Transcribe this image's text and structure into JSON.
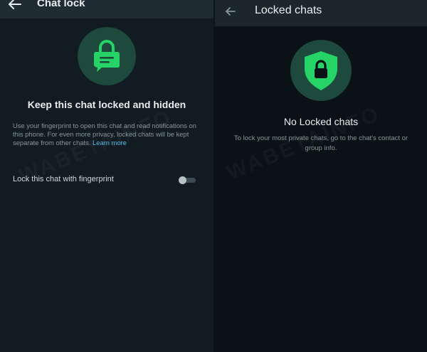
{
  "chat_lock_screen": {
    "title": "Chat lock",
    "heading": "Keep this chat locked and hidden",
    "description": "Use your fingerprint to open this chat and read notifications on this phone. For even more privacy, locked chats will be kept separate from other chats.",
    "learn_more": "Learn more",
    "fingerprint_label": "Lock this chat with fingerprint",
    "fingerprint_enabled": false,
    "icon": "chat-lock-icon"
  },
  "locked_chats_screen": {
    "title": "Locked chats",
    "heading": "No Locked chats",
    "description": "To lock your most private chats, go to the chat's contact or group info.",
    "icon": "shield-lock-icon"
  },
  "watermark": "WABETAINFO",
  "colors": {
    "accent_green": "#25d366",
    "badge_bg": "#1d4a3c",
    "background": "#111b21",
    "link_blue": "#53bdeb"
  }
}
